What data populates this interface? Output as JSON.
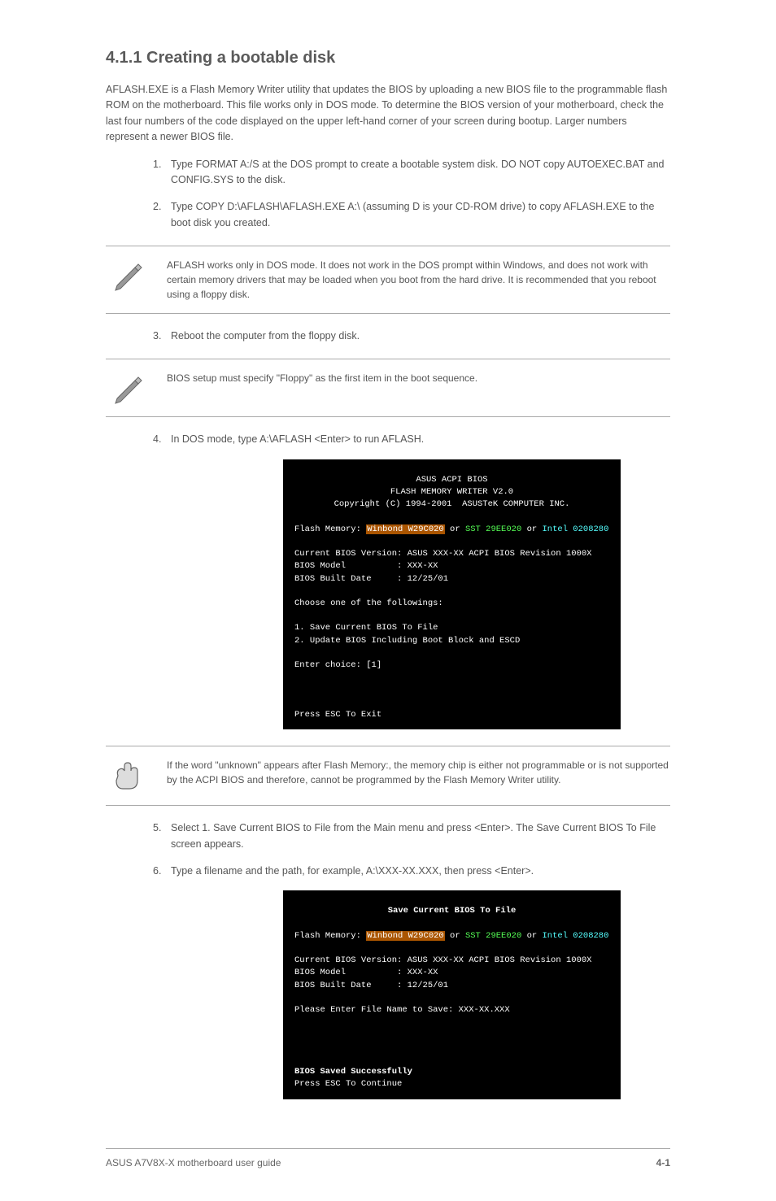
{
  "heading_sub": "4.1.1 Creating a bootable disk",
  "para_intro": "AFLASH.EXE is a Flash Memory Writer utility that updates the BIOS by uploading a new BIOS file to the programmable flash ROM on the motherboard. This file works only in DOS mode. To determine the BIOS version of your motherboard, check the last four numbers of the code displayed on the upper left-hand corner of your screen during bootup. Larger numbers represent a newer BIOS file.",
  "steps": {
    "s1": "Type FORMAT A:/S at the DOS prompt to create a bootable system disk. DO NOT copy AUTOEXEC.BAT and CONFIG.SYS to the disk.",
    "s2": "Type COPY D:\\AFLASH\\AFLASH.EXE A:\\ (assuming D is your CD-ROM drive) to copy AFLASH.EXE to the boot disk you created.",
    "s3": "Reboot the computer from the floppy disk.",
    "s4": "In DOS mode, type A:\\AFLASH <Enter> to run AFLASH.",
    "s5": "Select 1. Save Current BIOS to File from the Main menu and press <Enter>. The Save Current BIOS To File screen appears.",
    "s6": "Type a filename and the path, for example, A:\\XXX-XX.XXX, then press <Enter>."
  },
  "notes": {
    "n1": "AFLASH works only in DOS mode. It does not work in the DOS prompt within Windows, and does not work with certain memory drivers that may be loaded when you boot from the hard drive. It is recommended that you reboot using a floppy disk.",
    "n2": "BIOS setup must specify \"Floppy\" as the first item in the boot sequence.",
    "n3": "If the word \"unknown\" appears after Flash Memory:, the memory chip is either not programmable or is not supported by the ACPI BIOS and therefore, cannot be programmed by the Flash Memory Writer utility."
  },
  "terminal1": {
    "title1": "ASUS ACPI BIOS",
    "title2": "FLASH MEMORY WRITER V2.0",
    "title3": "Copyright (C) 1994-2001  ASUSTeK COMPUTER INC.",
    "flash_label": "Flash Memory: ",
    "flash_a": "Winbond W29C020",
    "flash_or1": " or ",
    "flash_b": "SST 29EE020",
    "flash_or2": " or ",
    "flash_c": "Intel 0208280",
    "ver": "Current BIOS Version: ASUS XXX-XX ACPI BIOS Revision 1000X",
    "model": "BIOS Model          : XXX-XX",
    "date": "BIOS Built Date     : 12/25/01",
    "choose": "Choose one of the followings:",
    "opt1": "1. Save Current BIOS To File",
    "opt2": "2. Update BIOS Including Boot Block and ESCD",
    "enter": "Enter choice: [1]",
    "esc": "Press ESC To Exit"
  },
  "terminal2": {
    "title": "Save Current BIOS To File",
    "flash_label": "Flash Memory: ",
    "flash_a": "Winbond W29C020",
    "flash_or1": " or ",
    "flash_b": "SST 29EE020",
    "flash_or2": " or ",
    "flash_c": "Intel 0208280",
    "ver": "Current BIOS Version: ASUS XXX-XX ACPI BIOS Revision 1000X",
    "model": "BIOS Model          : XXX-XX",
    "date": "BIOS Built Date     : 12/25/01",
    "prompt": "Please Enter File Name to Save: XXX-XX.XXX",
    "saved": "BIOS Saved Successfully",
    "esc": "Press ESC To Continue"
  },
  "footer": {
    "left": "ASUS A7V8X-X motherboard user guide",
    "right": "4-1"
  }
}
